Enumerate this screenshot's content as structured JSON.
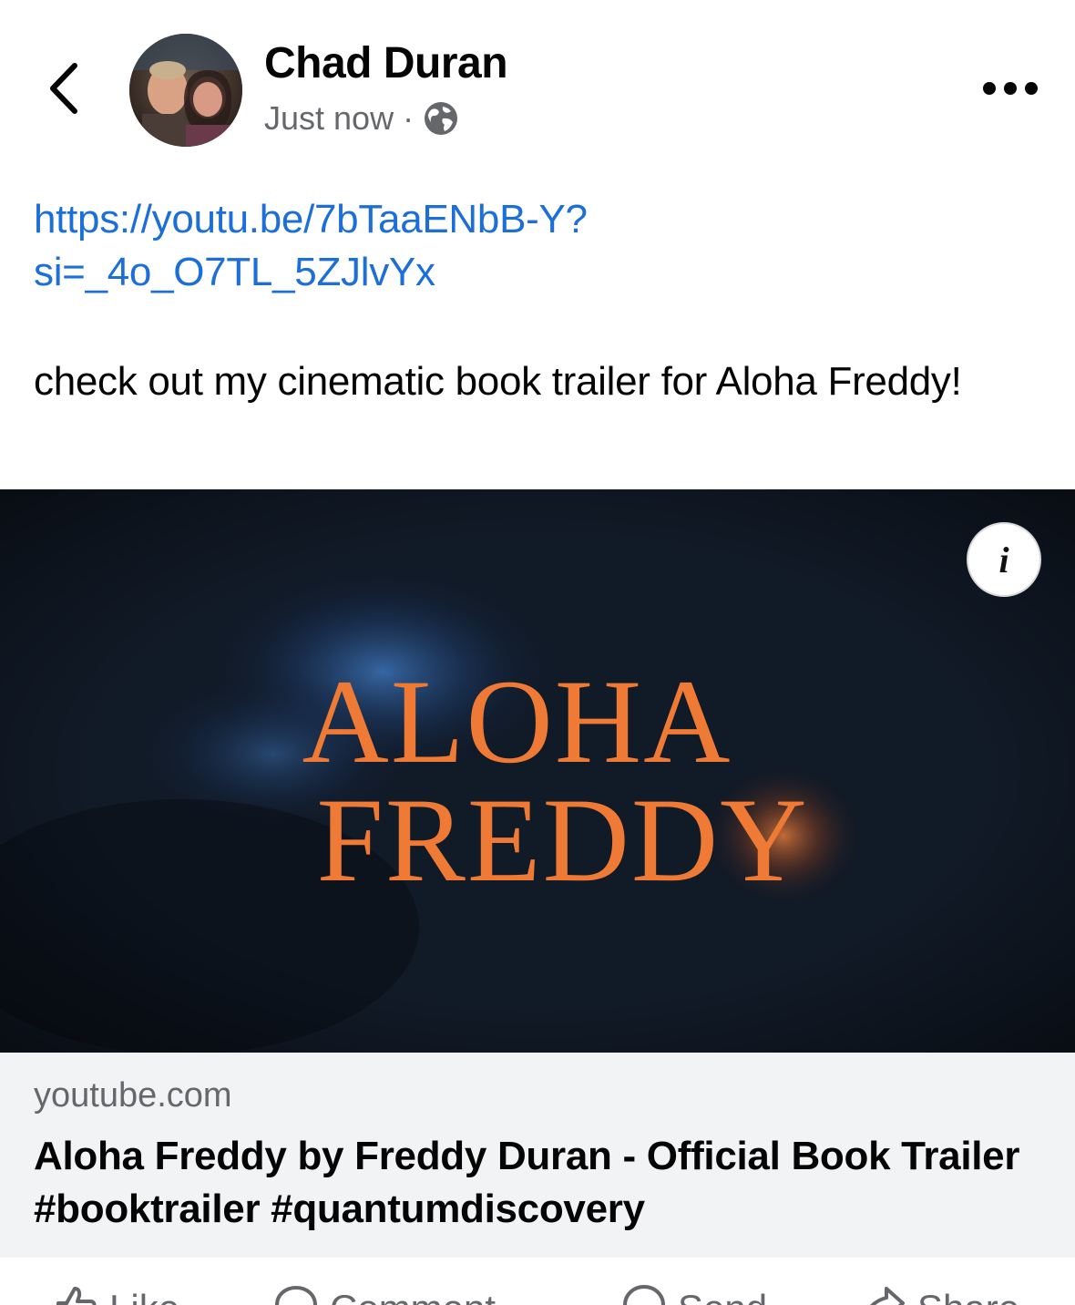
{
  "header": {
    "back_icon": "chevron-left-icon",
    "author_name": "Chad Duran",
    "timestamp": "Just now",
    "separator": "·",
    "privacy_icon": "globe-icon",
    "more_icon": "more-horizontal-icon"
  },
  "post": {
    "link": "https://youtu.be/7bTaaENbB-Y?\nsi=_4o_O7TL_5ZJlvYx",
    "text": "check out my cinematic book trailer for Aloha Freddy!"
  },
  "preview": {
    "title_line1": "ALOHA",
    "title_line2": "FREDDY",
    "info_label": "i",
    "title_color": "#ee7a35"
  },
  "link_card": {
    "domain": "youtube.com",
    "title": "Aloha Freddy by Freddy Duran - Official Book Trailer #booktrailer #quantumdiscovery"
  },
  "actions": {
    "like_label": "Like",
    "comment_label": "Comment",
    "send_label": "Send",
    "share_label": "Share"
  },
  "colors": {
    "link": "#1c6fd8",
    "secondary_text": "#65676b",
    "card_bg": "#f2f3f5"
  }
}
